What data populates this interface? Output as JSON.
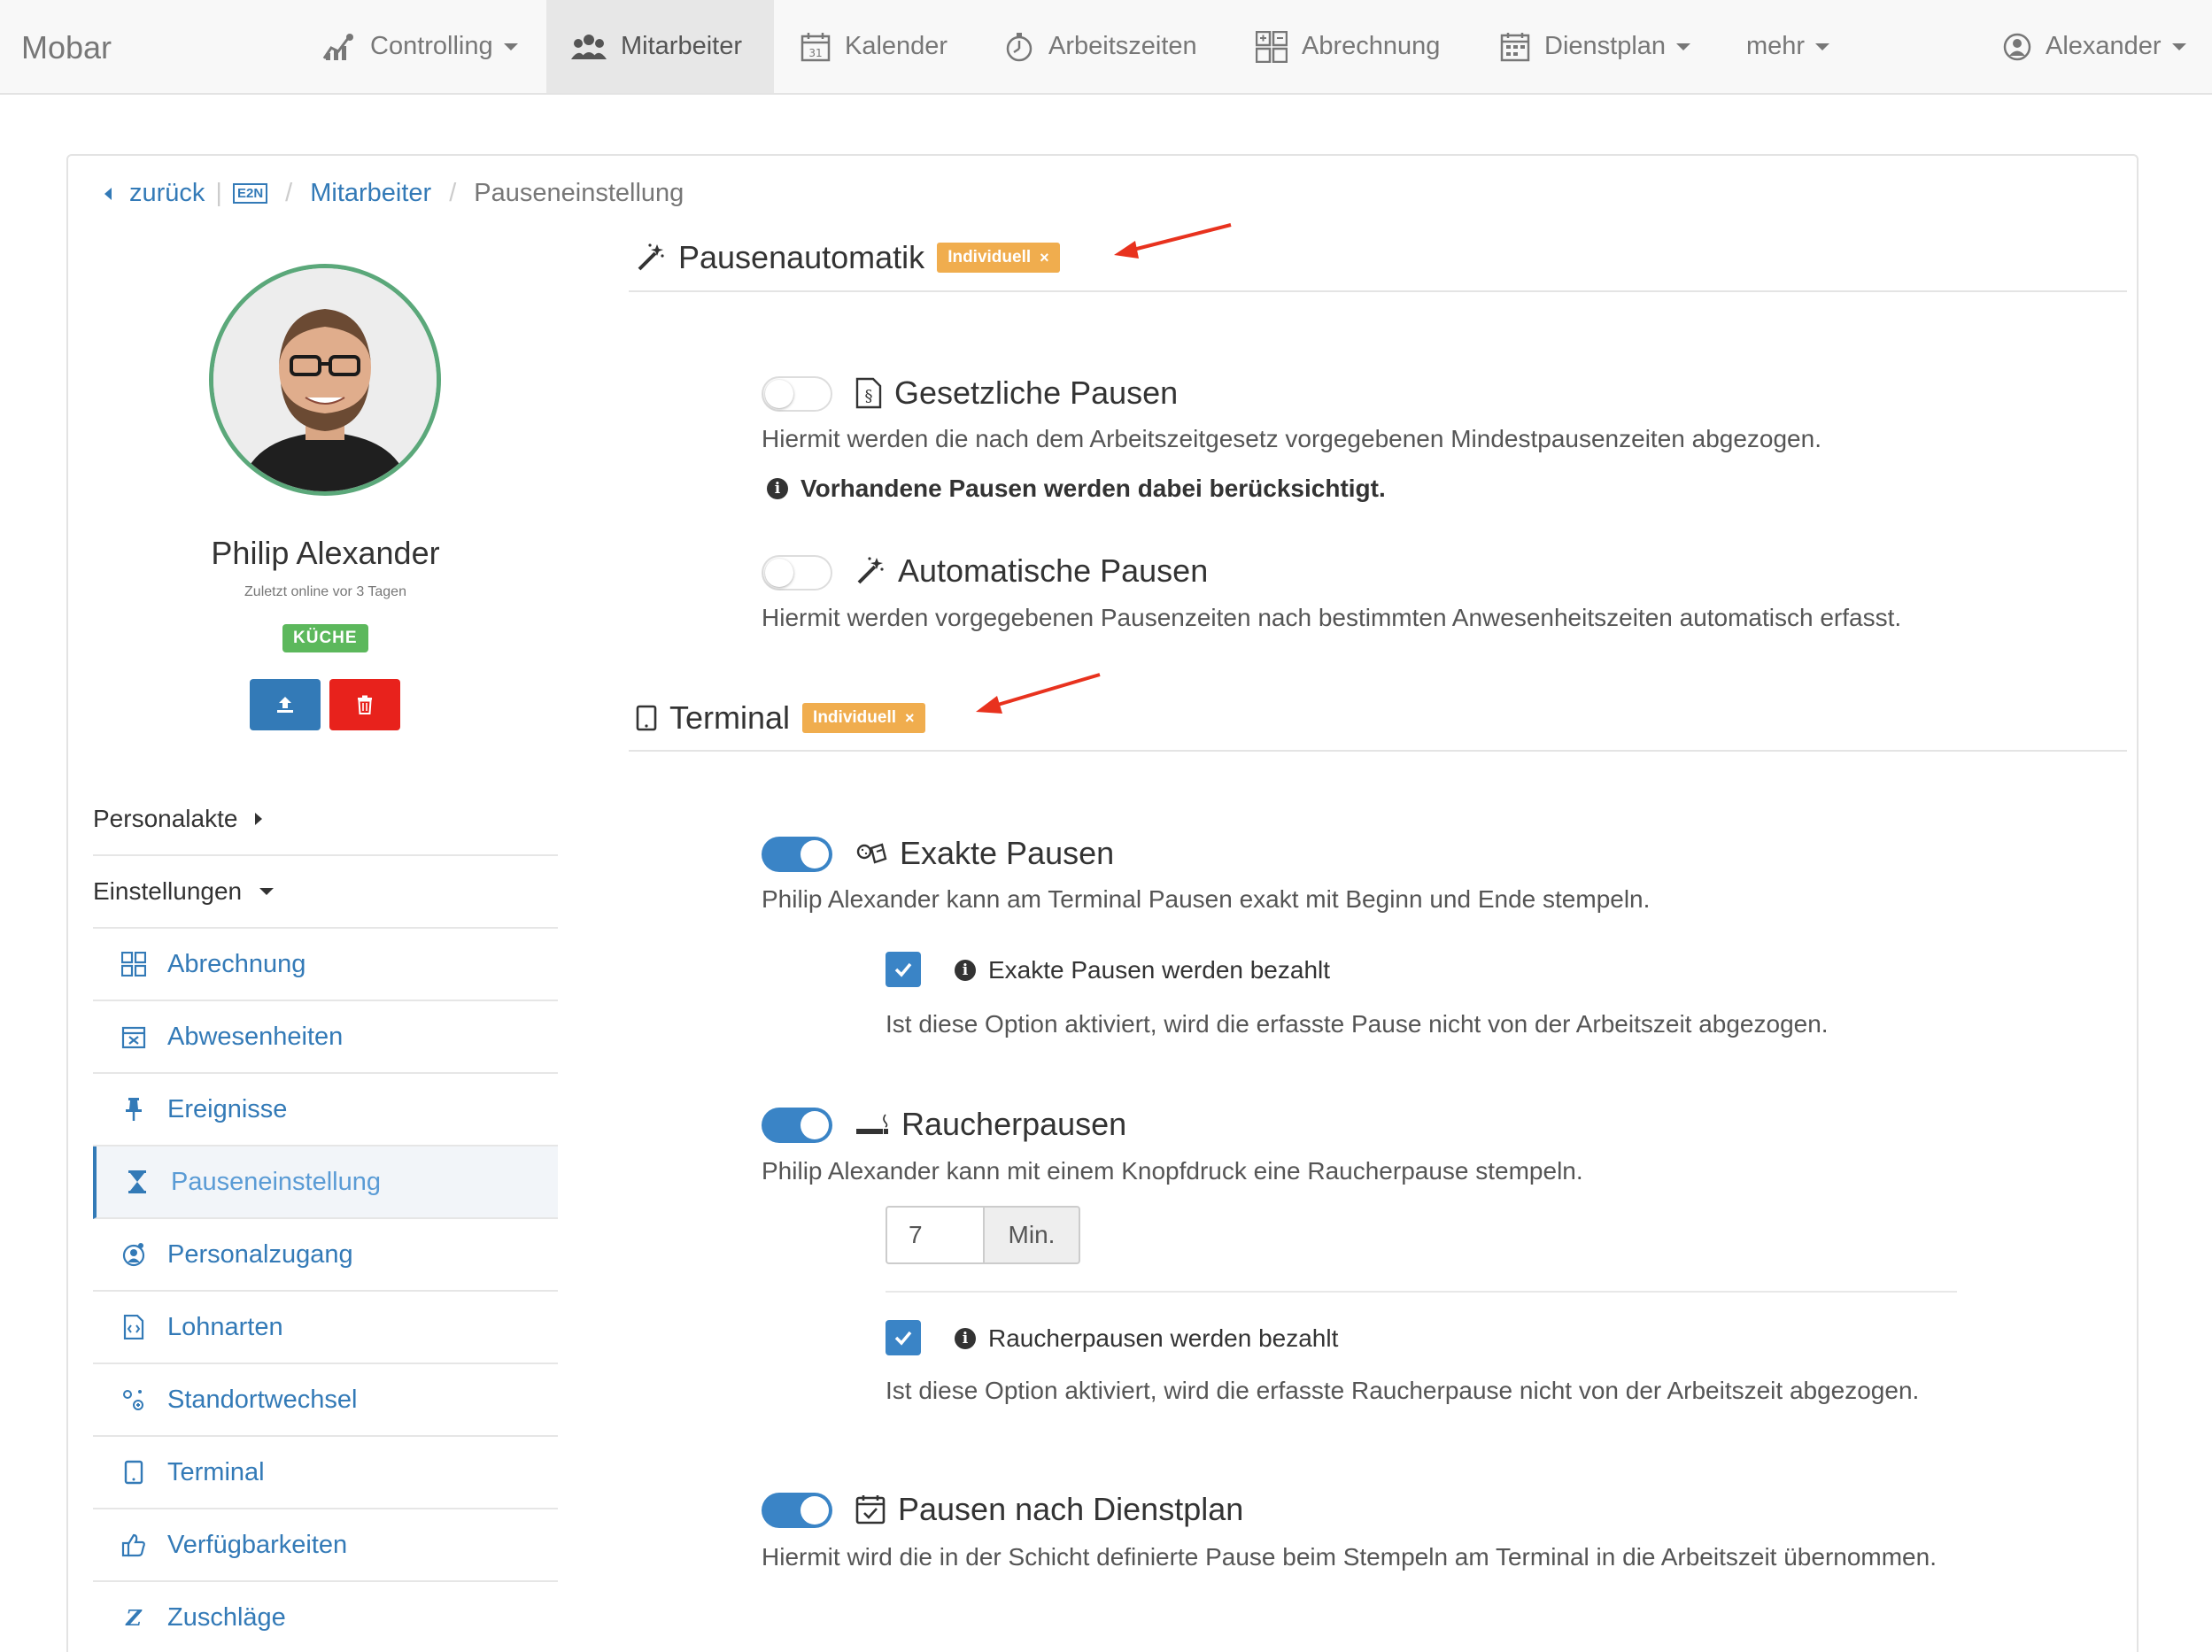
{
  "navbar": {
    "brand": "Mobar",
    "items": [
      {
        "label": "Controlling",
        "icon": "chart-icon",
        "dropdown": true
      },
      {
        "label": "Mitarbeiter",
        "icon": "team-icon",
        "active": true
      },
      {
        "label": "Kalender",
        "icon": "calendar-icon"
      },
      {
        "label": "Arbeitszeiten",
        "icon": "stopwatch-icon"
      },
      {
        "label": "Abrechnung",
        "icon": "calculator-icon"
      },
      {
        "label": "Dienstplan",
        "icon": "schedule-icon",
        "dropdown": true
      },
      {
        "label": "mehr",
        "dropdown": true
      }
    ],
    "user": "Alexander"
  },
  "breadcrumb": {
    "back": "zurück",
    "badge": "E2N",
    "parent": "Mitarbeiter",
    "current": "Pauseneinstellung"
  },
  "profile": {
    "name": "Philip Alexander",
    "last_online": "Zuletzt online vor 3 Tagen",
    "department": "KÜCHE"
  },
  "sidebar": {
    "personalakte": "Personalakte",
    "einstellungen": "Einstellungen",
    "items": [
      {
        "label": "Abrechnung",
        "icon": "calculator-icon"
      },
      {
        "label": "Abwesenheiten",
        "icon": "calendar-x-icon"
      },
      {
        "label": "Ereignisse",
        "icon": "pin-icon"
      },
      {
        "label": "Pauseneinstellung",
        "icon": "hourglass-icon",
        "active": true
      },
      {
        "label": "Personalzugang",
        "icon": "user-access-icon"
      },
      {
        "label": "Lohnarten",
        "icon": "document-code-icon"
      },
      {
        "label": "Standortwechsel",
        "icon": "location-switch-icon"
      },
      {
        "label": "Terminal",
        "icon": "tablet-icon"
      },
      {
        "label": "Verfügbarkeiten",
        "icon": "thumbs-up-icon"
      },
      {
        "label": "Zuschläge",
        "icon": "z-icon"
      }
    ]
  },
  "sections": {
    "pausenautomatik": {
      "title": "Pausenautomatik",
      "tag": "Individuell",
      "tag_close": "×"
    },
    "terminal": {
      "title": "Terminal",
      "tag": "Individuell",
      "tag_close": "×"
    }
  },
  "options": {
    "gesetzliche": {
      "title": "Gesetzliche Pausen",
      "enabled": false,
      "desc": "Hiermit werden die nach dem Arbeitszeitgesetz vorgegebenen Mindestpausenzeiten abgezogen.",
      "info": "Vorhandene Pausen werden dabei berücksichtigt."
    },
    "automatische": {
      "title": "Automatische Pausen",
      "enabled": false,
      "desc": "Hiermit werden vorgegebenen Pausenzeiten nach bestimmten Anwesenheitszeiten automatisch erfasst."
    },
    "exakte": {
      "title": "Exakte Pausen",
      "enabled": true,
      "desc": "Philip Alexander kann am Terminal Pausen exakt mit Beginn und Ende stempeln.",
      "check_label": "Exakte Pausen werden bezahlt",
      "check_desc": "Ist diese Option aktiviert, wird die erfasste Pause nicht von der Arbeitszeit abgezogen."
    },
    "raucher": {
      "title": "Raucherpausen",
      "enabled": true,
      "desc": "Philip Alexander kann mit einem Knopfdruck eine Raucherpause stempeln.",
      "minutes": "7",
      "minutes_unit": "Min.",
      "check_label": "Raucherpausen werden bezahlt",
      "check_desc": "Ist diese Option aktiviert, wird die erfasste Raucherpause nicht von der Arbeitszeit abgezogen."
    },
    "dienstplan": {
      "title": "Pausen nach Dienstplan",
      "enabled": true,
      "desc": "Hiermit wird die in der Schicht definierte Pause beim Stempeln am Terminal in die Arbeitszeit übernommen."
    }
  },
  "colors": {
    "primary": "#337ab7",
    "toggle_on": "#3a84c6",
    "tag": "#f0ad4e",
    "success": "#5cb85c",
    "danger": "#e8221c",
    "avatar_ring": "#5ba87a",
    "annotation_arrow": "#e8321e"
  }
}
